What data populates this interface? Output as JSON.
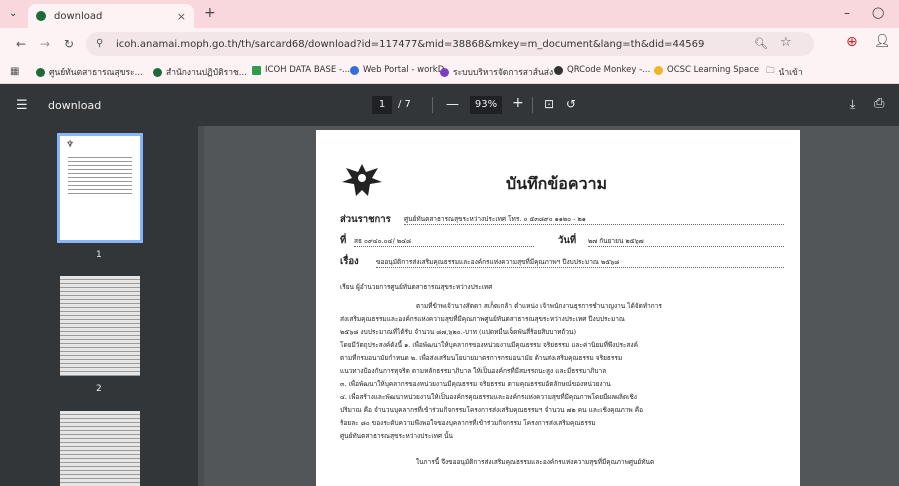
{
  "browser": {
    "tab_title": "download",
    "url": "icoh.anamai.moph.go.th/th/sarcard68/download?id=117477&mid=38868&mkey=m_document&lang=th&did=44569",
    "bookmarks": [
      {
        "label": "ศูนย์ทันตสาธารณสุขระ...",
        "color": "#1f6a3a"
      },
      {
        "label": "สำนักงานปฏิบัติราช...",
        "color": "#1f6a3a"
      },
      {
        "label": "ICOH DATA BASE -...",
        "color": "#2e9e4c"
      },
      {
        "label": "Web Portal - workD",
        "color": "#2f6fd6"
      },
      {
        "label": "ระบบบริหารจัดการสาส์นส่ง",
        "color": "#7a3fbf"
      },
      {
        "label": "QRCode Monkey -...",
        "color": "#333333"
      },
      {
        "label": "OCSC Learning Space",
        "color": "#f0b429"
      },
      {
        "label": "นำเข้า",
        "color": "#555555"
      }
    ]
  },
  "pdf": {
    "title": "download",
    "page_current": "1",
    "page_total": "/ 7",
    "zoom": "93%",
    "thumbnails": [
      "1",
      "2"
    ]
  },
  "document": {
    "heading": "บันทึกข้อความ",
    "agency_label": "ส่วนราชการ",
    "agency_value": "ศูนย์ทันตสาธารณสุขระหว่างประเทศ   โทร. ๐ ๕๓๘๙๐ ๑๑๒๐ - ๒๑",
    "ref_label": "ที่",
    "ref_value": "สธ ๐๙๔๐.๐๔/ ๒๔๘",
    "date_label": "วันที่",
    "date_value": "๒๗ กันยายน ๒๕๖๗",
    "subject_label": "เรื่อง",
    "subject_value": "ขออนุมัติการส่งเสริมคุณธรรมและองค์กรแห่งความสุขที่มีคุณภาพฯ ปีงบประมาณ ๒๕๖๘",
    "salutation": "เรียน   ผู้อำนวยการศูนย์ทันตสาธารณสุขระหว่างประเทศ",
    "paragraphs": [
      "ตามที่ข้าพเจ้านางสัตดา สเก็ตเกล้า ตำแหน่ง เจ้าพนักงานธุรการชำนาญงาน ได้จัดทำการ",
      "ส่งเสริมคุณธรรมและองค์กรแห่งความสุขที่มีคุณภาพศูนย์ทันตสาธารณสุขระหว่างประเทศ ปีงบประมาณ",
      "๒๕๖๘ งบประมาณที่ได้รับ จำนวน ๘๗,๖๒๐.-บาท (แปดหมื่นเจ็ดพันสี่ร้อยสิบบาทถ้วน)",
      "โดยมีวัตถุประสงค์ดังนี้  ๑. เพื่อพัฒนาให้บุคลากรของหน่วยงานมีคุณธรรม จริยธรรม และค่านิยมที่พึงประสงค์",
      "ตามที่กรมอนามัยกำหนด ๒. เพื่อส่งเสริมนโยบายมาตรการกรมอนามัย ด้านส่งเสริมคุณธรรม จริยธรรม",
      "แนวทางป้องกันการทุจริต ตามหลักธรรมาภิบาล ให้เป็นองค์กรที่มีสมรรถนะสูง และมีธรรมาภิบาล",
      "๓. เพื่อพัฒนาให้บุคลากรของหน่วยงานมีคุณธรรม จริยธรรม ตามคุณธรรมอัตลักษณ์ของหน่วยงาน",
      "๔. เพื่อสร้างและพัฒนาหน่วยงานให้เป็นองค์กรคุณธรรมและองค์กรแห่งความสุขที่มีคุณภาพโดยมีผลผลิตเชิง",
      "ปริมาณ คือ จำนวนบุคลากรที่เข้าร่วมกิจกรรมโครงการส่งเสริมคุณธรรมฯ จำนวน ๗๒ คน และเชิงคุณภาพ คือ",
      "ร้อยละ ๘๐ ของระดับความพึงพอใจของบุคลากรที่เข้าร่วมกิจกรรม โครงการส่งเสริมคุณธรรม",
      "ศูนย์ทันตสาธารณสุขระหว่างประเทศ นั้น",
      "ในการนี้ จึงขออนุมัติการส่งเสริมคุณธรรมและองค์กรแห่งความสุขที่มีคุณภาพศูนย์ทันต"
    ]
  }
}
